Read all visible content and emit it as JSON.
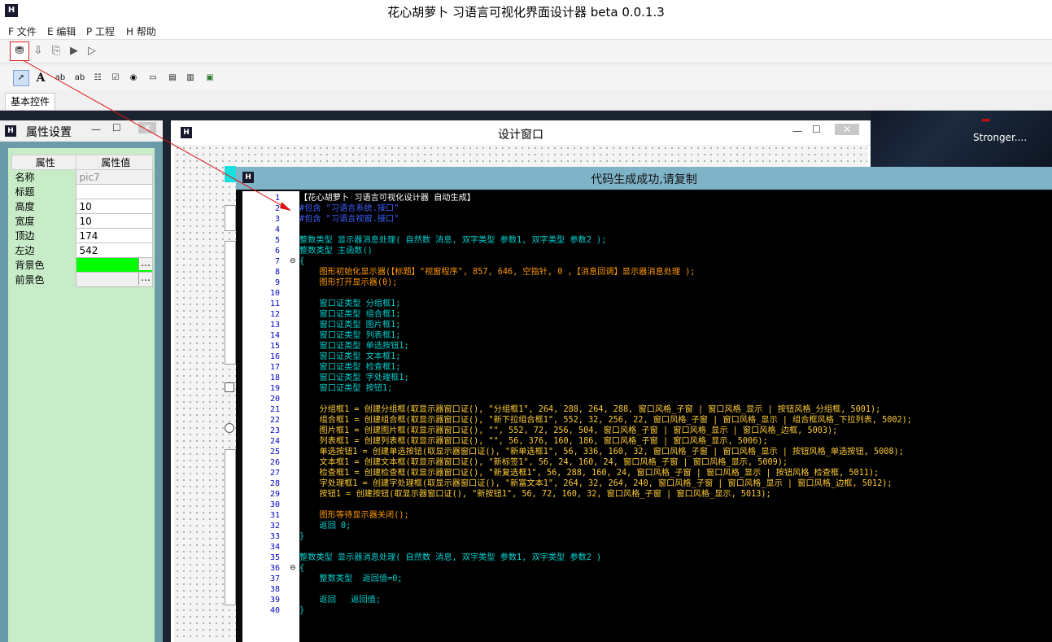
{
  "app": {
    "title": "花心胡萝卜 习语言可视化界面设计器 beta 0.0.1.3",
    "icon_letter": "H"
  },
  "menu": [
    "F 文件",
    "E 编辑",
    "P 工程",
    "H 帮助"
  ],
  "toolbar_tab": "基本控件",
  "desktop_label": "Stronger....",
  "property_panel": {
    "title": "属性设置",
    "headers": [
      "属性",
      "属性值"
    ],
    "rows": [
      {
        "key": "名称",
        "value": "pic7"
      },
      {
        "key": "标题",
        "value": ""
      },
      {
        "key": "高度",
        "value": "10"
      },
      {
        "key": "宽度",
        "value": "10"
      },
      {
        "key": "顶边",
        "value": "174"
      },
      {
        "key": "左边",
        "value": "542"
      },
      {
        "key": "背景色",
        "value": ""
      },
      {
        "key": "前景色",
        "value": ""
      }
    ],
    "bg_color": "#00ff00"
  },
  "design_window": {
    "title": "设计窗口"
  },
  "code_window": {
    "title": "代码生成成功,请复制",
    "lines": [
      "【花心胡萝卜 习语言可视化设计器 自动生成】",
      "#包含 \"习语言系统.接口\"",
      "#包含 \"习语言视窗.接口\"",
      "",
      "整数类型 显示器消息处理( 自然数 消息, 双字类型 参数1, 双字类型 参数2 );",
      "整数类型 主函数()",
      "{",
      "    图形初始化显示器(【标题】\"视窗程序\", 857, 646, 空指针, 0 ,【消息回调】显示器消息处理 );",
      "    图形打开显示器(0);",
      "",
      "    窗口证类型 分组框1;",
      "    窗口证类型 组合框1;",
      "    窗口证类型 图片框1;",
      "    窗口证类型 列表框1;",
      "    窗口证类型 单选按钮1;",
      "    窗口证类型 文本框1;",
      "    窗口证类型 检查框1;",
      "    窗口证类型 字处理框1;",
      "    窗口证类型 按钮1;",
      "",
      "    分组框1 = 创建分组框(取显示器窗口证(), \"分组框1\", 264, 288, 264, 288, 窗口风格_子窗 | 窗口风格_显示 | 按钮风格_分组框, 5001);",
      "    组合框1 = 创建组合框(取显示器窗口证(), \"新下拉组合框1\", 552, 32, 256, 22, 窗口风格_子窗 | 窗口风格_显示 | 组合框风格_下拉列表, 5002);",
      "    图片框1 = 创建图片框(取显示器窗口证(), \"\", 552, 72, 256, 504, 窗口风格_子窗 | 窗口风格_显示 | 窗口风格_边框, 5003);",
      "    列表框1 = 创建列表框(取显示器窗口证(), \"\", 56, 376, 160, 186, 窗口风格_子窗 | 窗口风格_显示, 5006);",
      "    单选按钮1 = 创建单选按钮(取显示器窗口证(), \"新单选框1\", 56, 336, 160, 32, 窗口风格_子窗 | 窗口风格_显示 | 按钮风格_单选按钮, 5008);",
      "    文本框1 = 创建文本框(取显示器窗口证(), \"新标签1\", 56, 24, 160, 24, 窗口风格_子窗 | 窗口风格_显示, 5009);",
      "    检查框1 = 创建检查框(取显示器窗口证(), \"新复选框1\", 56, 288, 160, 24, 窗口风格_子窗 | 窗口风格_显示 | 按钮风格_检查框, 5011);",
      "    字处理框1 = 创建字处理框(取显示器窗口证(), \"新富文本1\", 264, 32, 264, 240, 窗口风格_子窗 | 窗口风格_显示 | 窗口风格_边框, 5012);",
      "    按钮1 = 创建按钮(取显示器窗口证(), \"新按钮1\", 56, 72, 160, 32, 窗口风格_子窗 | 窗口风格_显示, 5013);",
      "",
      "    图形等待显示器关闭();",
      "    返回 0;",
      "}",
      "",
      "整数类型 显示器消息处理( 自然数 消息, 双字类型 参数1, 双字类型 参数2 )",
      "{",
      "    整数类型  返回值=0;",
      "",
      "    返回   返回值;",
      "}"
    ],
    "line_colors": [
      "#ffffff",
      "#4060ff",
      "#4060ff",
      "#e0e0e0",
      "#00d0d0",
      "#00d0d0",
      "#00d0d0",
      "#ff9900",
      "#ff9900",
      "#e0e0e0",
      "#00d0d0",
      "#00d0d0",
      "#00d0d0",
      "#00d0d0",
      "#00d0d0",
      "#00d0d0",
      "#00d0d0",
      "#00d0d0",
      "#00d0d0",
      "#e0e0e0",
      "#ffcc33",
      "#ffcc33",
      "#ffcc33",
      "#ffcc33",
      "#ffcc33",
      "#ffcc33",
      "#ffcc33",
      "#ffcc33",
      "#ffcc33",
      "#e0e0e0",
      "#ff9900",
      "#00d0d0",
      "#00d0d0",
      "#e0e0e0",
      "#00d0d0",
      "#00d0d0",
      "#00d0d0",
      "#e0e0e0",
      "#00d0d0",
      "#00d0d0"
    ],
    "fold_lines": [
      7,
      36
    ]
  }
}
